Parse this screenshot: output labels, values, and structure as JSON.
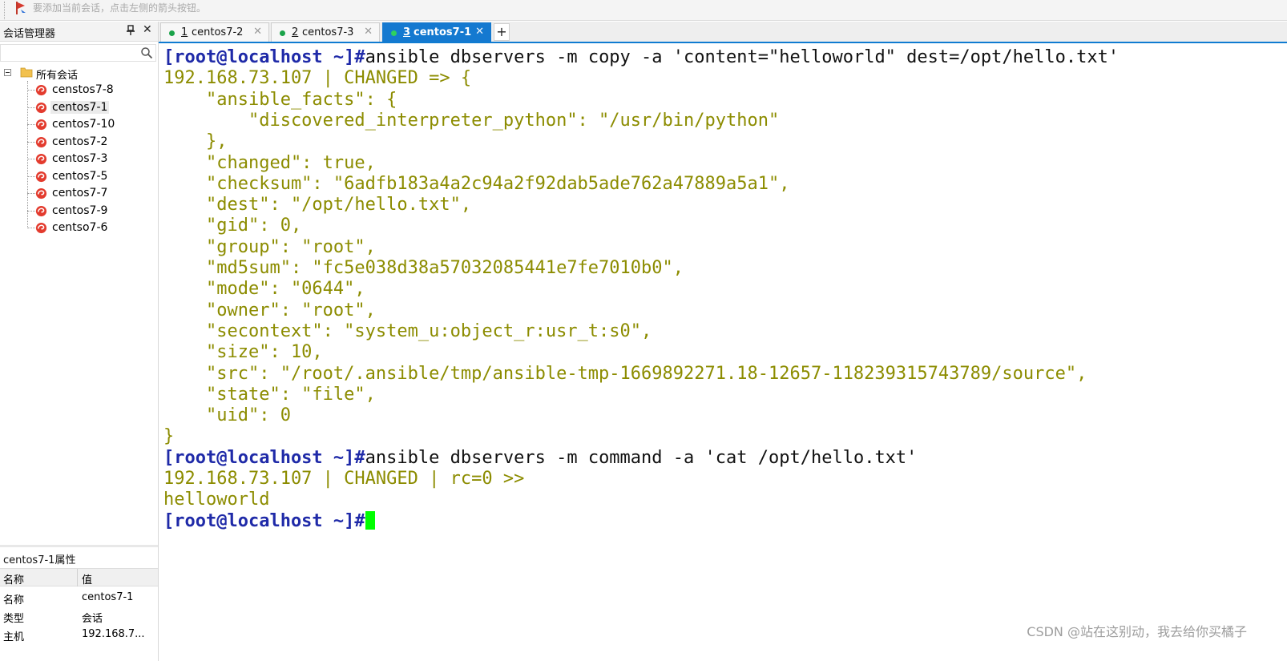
{
  "hint_bar": {
    "text": "要添加当前会话，点击左侧的箭头按钮。"
  },
  "session_manager": {
    "title": "会话管理器",
    "search_placeholder": "",
    "root_label": "所有会话",
    "items": [
      {
        "label": "censtos7-8"
      },
      {
        "label": "centos7-1",
        "selected": true
      },
      {
        "label": "centos7-10"
      },
      {
        "label": "centos7-2"
      },
      {
        "label": "centos7-3"
      },
      {
        "label": "centos7-5"
      },
      {
        "label": "centos7-7"
      },
      {
        "label": "centos7-9"
      },
      {
        "label": "centso7-6"
      }
    ]
  },
  "properties": {
    "title": "centos7-1属性",
    "col_name": "名称",
    "col_value": "值",
    "rows": [
      {
        "key": "名称",
        "value": "centos7-1"
      },
      {
        "key": "类型",
        "value": "会话"
      },
      {
        "key": "主机",
        "value": "192.168.7..."
      }
    ]
  },
  "tabs": [
    {
      "num": "1",
      "name": "centos7-2",
      "active": false
    },
    {
      "num": "2",
      "name": "centos7-3",
      "active": false
    },
    {
      "num": "3",
      "name": "centos7-1",
      "active": true
    }
  ],
  "tab_add_label": "+",
  "terminal": {
    "lines": [
      {
        "prompt": "[root@localhost ~]#",
        "text": "ansible dbservers -m copy -a 'content=\"helloworld\" dest=/opt/hello.txt'"
      },
      {
        "text": "192.168.73.107 | CHANGED => {"
      },
      {
        "text": "    \"ansible_facts\": {"
      },
      {
        "text": "        \"discovered_interpreter_python\": \"/usr/bin/python\""
      },
      {
        "text": "    },"
      },
      {
        "text": "    \"changed\": true,"
      },
      {
        "text": "    \"checksum\": \"6adfb183a4a2c94a2f92dab5ade762a47889a5a1\","
      },
      {
        "text": "    \"dest\": \"/opt/hello.txt\","
      },
      {
        "text": "    \"gid\": 0,"
      },
      {
        "text": "    \"group\": \"root\","
      },
      {
        "text": "    \"md5sum\": \"fc5e038d38a57032085441e7fe7010b0\","
      },
      {
        "text": "    \"mode\": \"0644\","
      },
      {
        "text": "    \"owner\": \"root\","
      },
      {
        "text": "    \"secontext\": \"system_u:object_r:usr_t:s0\","
      },
      {
        "text": "    \"size\": 10,"
      },
      {
        "text": "    \"src\": \"/root/.ansible/tmp/ansible-tmp-1669892271.18-12657-118239315743789/source\","
      },
      {
        "text": "    \"state\": \"file\","
      },
      {
        "text": "    \"uid\": 0"
      },
      {
        "text": "}"
      },
      {
        "prompt": "[root@localhost ~]#",
        "text": "ansible dbservers -m command -a 'cat /opt/hello.txt'"
      },
      {
        "text": "192.168.73.107 | CHANGED | rc=0 >>"
      },
      {
        "text": "helloworld"
      },
      {
        "prompt": "[root@localhost ~]#",
        "text": "",
        "cursor": true
      }
    ]
  },
  "watermark": "CSDN @站在这别动，我去给你买橘子",
  "colors": {
    "prompt": "#1f2aa8",
    "output": "#8c8c00",
    "cursor": "#00ff00",
    "tab_active": "#1479d0",
    "status_dot": "#1aa34a"
  }
}
